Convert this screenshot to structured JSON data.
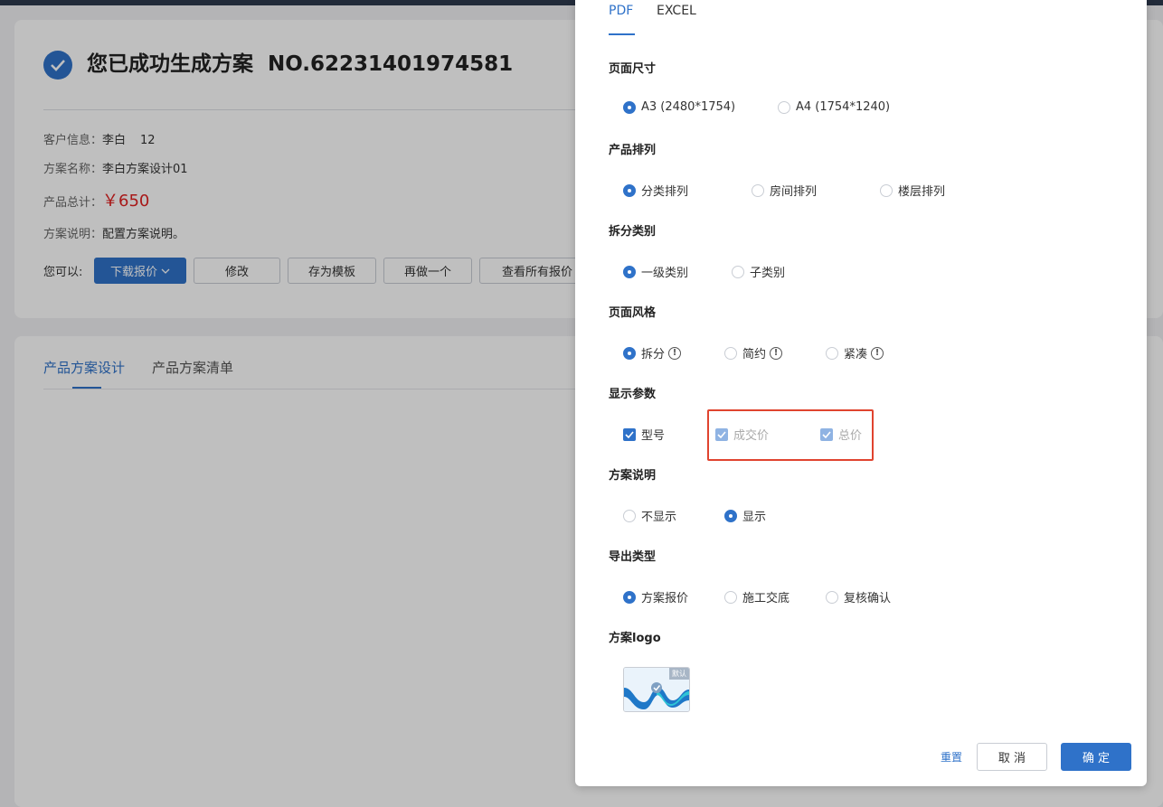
{
  "page": {
    "success_title": "您已成功生成方案",
    "scheme_no": "NO.62231401974581",
    "customer": {
      "label": "客户信息：",
      "name": "李白",
      "extra": "12"
    },
    "scheme_name": {
      "label": "方案名称：",
      "value": "李白方案设计01"
    },
    "total": {
      "label": "产品总计：",
      "value": "￥650"
    },
    "desc": {
      "label": "方案说明：",
      "value": "配置方案说明。"
    },
    "actions": {
      "label": "您可以:",
      "download": "下载报价",
      "modify": "修改",
      "save_template": "存为模板",
      "redo": "再做一个",
      "view_all": "查看所有报价"
    },
    "tabs": [
      "产品方案设计",
      "产品方案清单"
    ]
  },
  "drawer": {
    "tabs": [
      "PDF",
      "EXCEL"
    ],
    "page_size": {
      "title": "页面尺寸",
      "options": [
        "A3 (2480*1754)",
        "A4 (1754*1240)"
      ],
      "selected": 0
    },
    "arrangement": {
      "title": "产品排列",
      "options": [
        "分类排列",
        "房间排列",
        "楼层排列"
      ],
      "selected": 0
    },
    "split_category": {
      "title": "拆分类别",
      "options": [
        "一级类别",
        "子类别"
      ],
      "selected": 0
    },
    "page_style": {
      "title": "页面风格",
      "options": [
        "拆分",
        "简约",
        "紧凑"
      ],
      "selected": 0
    },
    "display_params": {
      "title": "显示参数",
      "options": [
        "型号",
        "成交价",
        "总价"
      ]
    },
    "scheme_desc": {
      "title": "方案说明",
      "options": [
        "不显示",
        "显示"
      ],
      "selected": 1
    },
    "export_type": {
      "title": "导出类型",
      "options": [
        "方案报价",
        "施工交底",
        "复核确认"
      ],
      "selected": 0
    },
    "logo": {
      "title": "方案logo",
      "badge": "默认"
    },
    "footer": {
      "reset": "重置",
      "cancel": "取 消",
      "confirm": "确 定"
    }
  },
  "colors": {
    "accent": "#2f72c9",
    "price": "#e02020",
    "highlight": "#e0442f"
  }
}
